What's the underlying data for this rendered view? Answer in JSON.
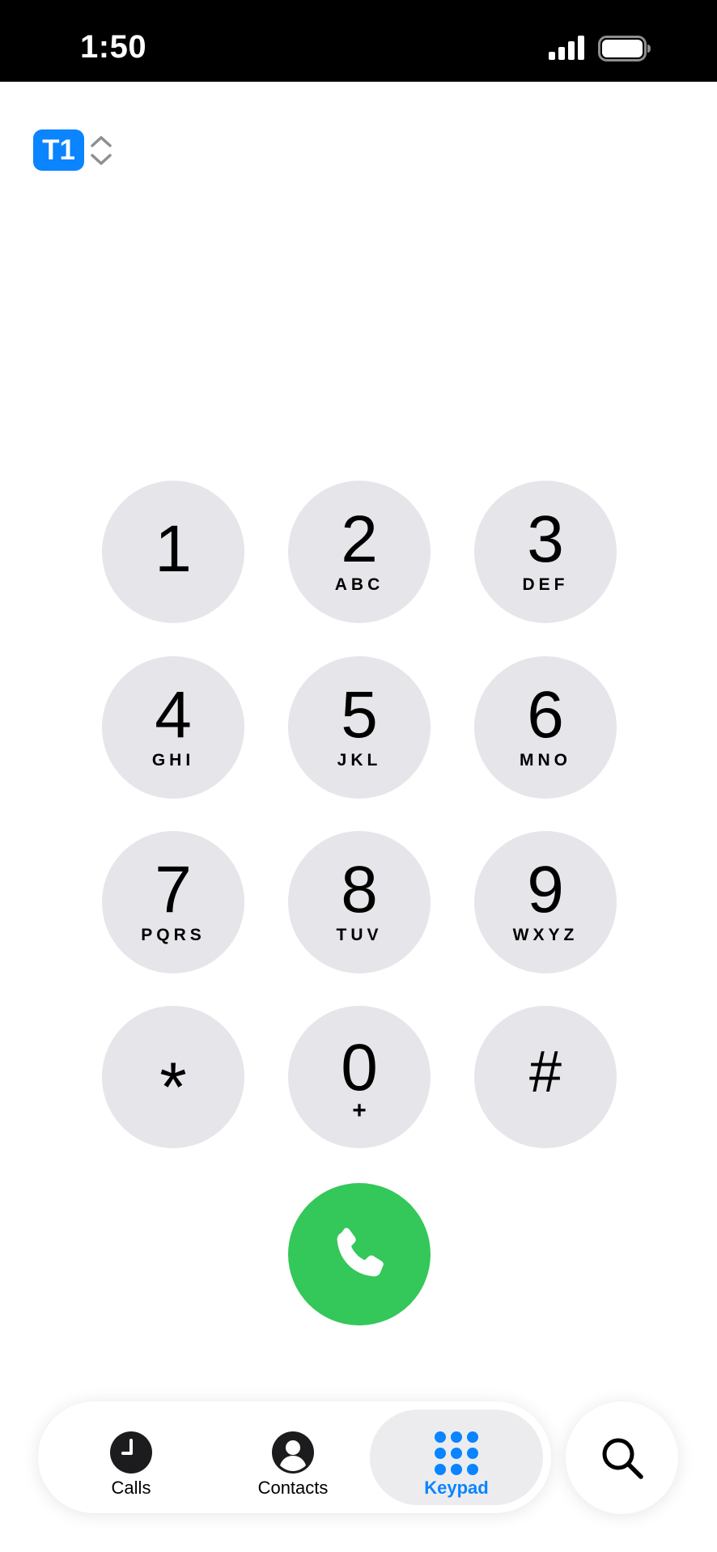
{
  "status_bar": {
    "time": "1:50",
    "icons": [
      "cellular-signal-icon",
      "battery-icon"
    ]
  },
  "line_selector": {
    "label": "T1",
    "accent_color": "#0a84ff",
    "icon": "chevron-up-down-icon"
  },
  "keypad": {
    "keys": [
      {
        "digit": "1",
        "letters": ""
      },
      {
        "digit": "2",
        "letters": "ABC"
      },
      {
        "digit": "3",
        "letters": "DEF"
      },
      {
        "digit": "4",
        "letters": "GHI"
      },
      {
        "digit": "5",
        "letters": "JKL"
      },
      {
        "digit": "6",
        "letters": "MNO"
      },
      {
        "digit": "7",
        "letters": "PQRS"
      },
      {
        "digit": "8",
        "letters": "TUV"
      },
      {
        "digit": "9",
        "letters": "WXYZ"
      },
      {
        "digit": "*",
        "letters": ""
      },
      {
        "digit": "0",
        "letters": "+"
      },
      {
        "digit": "#",
        "letters": ""
      }
    ],
    "key_color": "#e5e5ea"
  },
  "call_button": {
    "icon": "phone-icon",
    "color": "#34c759"
  },
  "tab_bar": {
    "tabs": [
      {
        "label": "Calls",
        "icon": "clock-icon",
        "active": false
      },
      {
        "label": "Contacts",
        "icon": "person-circle-icon",
        "active": false
      },
      {
        "label": "Keypad",
        "icon": "keypad-grid-icon",
        "active": true
      }
    ],
    "active_color": "#0a84ff"
  },
  "search": {
    "icon": "search-icon"
  }
}
